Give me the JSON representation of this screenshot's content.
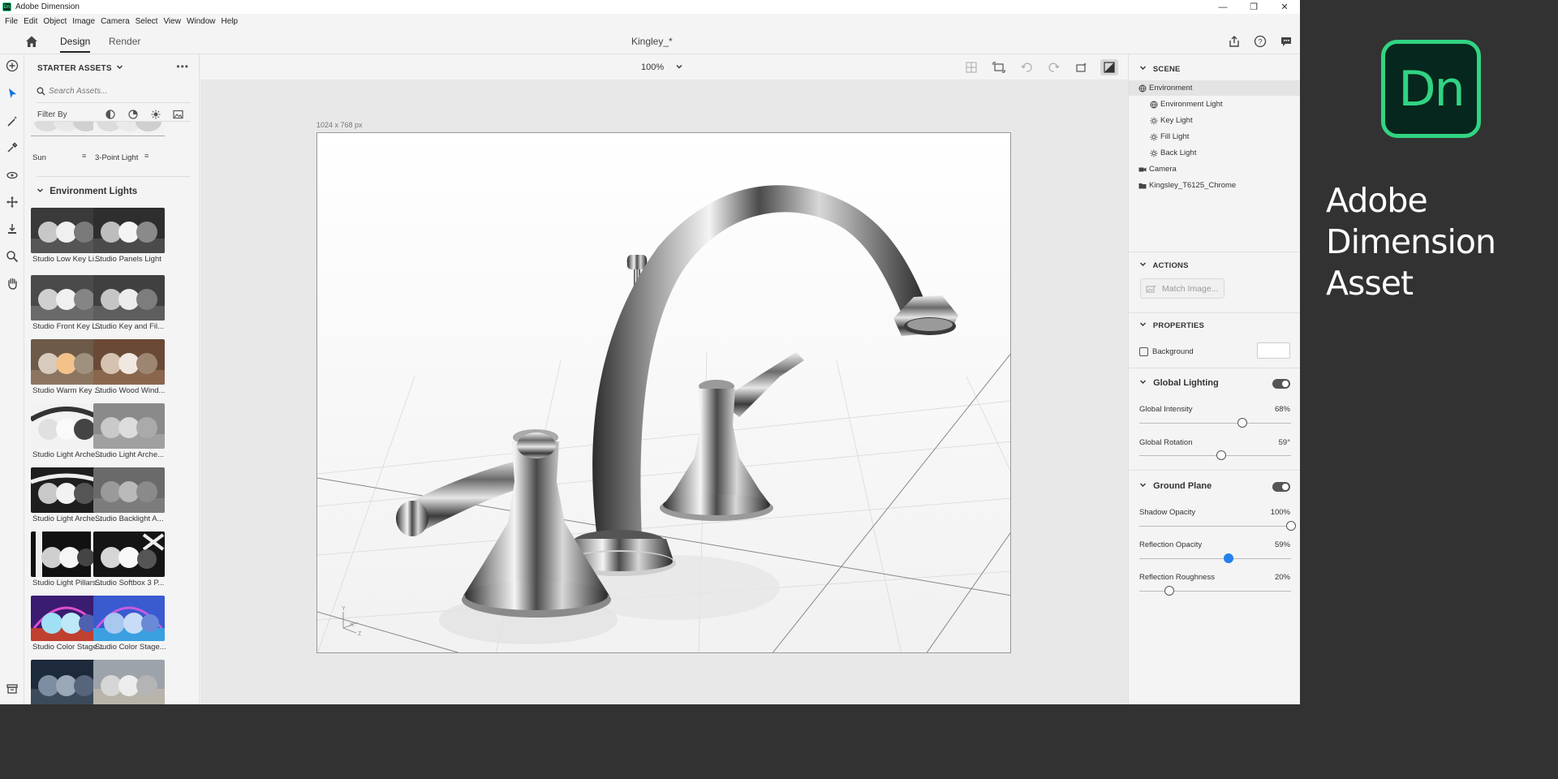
{
  "window": {
    "app_name": "Adobe Dimension",
    "app_logo": "Dn",
    "controls": [
      "minimize-icon",
      "restore-icon",
      "close-icon"
    ]
  },
  "menu": [
    "File",
    "Edit",
    "Object",
    "Image",
    "Camera",
    "Select",
    "View",
    "Window",
    "Help"
  ],
  "tabs": {
    "design": "Design",
    "render": "Render",
    "active": "Design"
  },
  "document": {
    "title": "Kingley_*",
    "size_label": "1024 x 768 px"
  },
  "canvas": {
    "zoom": "100%"
  },
  "assets": {
    "header": "STARTER ASSETS",
    "search_placeholder": "Search Assets...",
    "filter_label": "Filter By",
    "lights": [
      {
        "label": "Sun"
      },
      {
        "label": "3-Point Light"
      }
    ],
    "env_section": "Environment Lights",
    "env_items": [
      "Studio Low Key Li...",
      "Studio Panels Light",
      "Studio Front Key L...",
      "Studio Key and Fil...",
      "Studio Warm Key ...",
      "Studio Wood Wind...",
      "Studio Light Arche...",
      "Studio Light Arche...",
      "Studio Light Arche...",
      "Studio Backlight A...",
      "Studio Light Pillars...",
      "Studio Softbox 3 P...",
      "Studio Color Stage...",
      "Studio Color Stage...",
      "",
      ""
    ]
  },
  "scene": {
    "header": "SCENE",
    "items": [
      {
        "label": "Environment",
        "icon": "globe-icon",
        "level": 0,
        "selected": true
      },
      {
        "label": "Environment Light",
        "icon": "globe-icon",
        "level": 1
      },
      {
        "label": "Key Light",
        "icon": "sun-icon",
        "level": 1
      },
      {
        "label": "Fill Light",
        "icon": "sun-icon",
        "level": 1
      },
      {
        "label": "Back Light",
        "icon": "sun-icon",
        "level": 1
      },
      {
        "label": "Camera",
        "icon": "camera-icon",
        "level": 0
      },
      {
        "label": "Kingsley_T6125_Chrome",
        "icon": "folder-icon",
        "level": 0
      }
    ]
  },
  "actions": {
    "header": "ACTIONS",
    "match_image": "Match Image..."
  },
  "properties": {
    "header": "PROPERTIES",
    "background_label": "Background",
    "global_lighting": {
      "title": "Global Lighting",
      "enabled": true,
      "intensity_label": "Global Intensity",
      "intensity": "68%",
      "intensity_value": 0.68,
      "rotation_label": "Global Rotation",
      "rotation": "59°",
      "rotation_value": 0.54
    },
    "ground_plane": {
      "title": "Ground Plane",
      "enabled": true,
      "shadow_label": "Shadow Opacity",
      "shadow": "100%",
      "shadow_value": 1.0,
      "reflection_label": "Reflection Opacity",
      "reflection": "59%",
      "reflection_value": 0.59,
      "roughness_label": "Reflection Roughness",
      "roughness": "20%",
      "roughness_value": 0.2
    }
  },
  "brand": {
    "logo": "Dn",
    "line1": "Adobe Dimension",
    "line2": "Asset",
    "accent": "#31d483"
  }
}
